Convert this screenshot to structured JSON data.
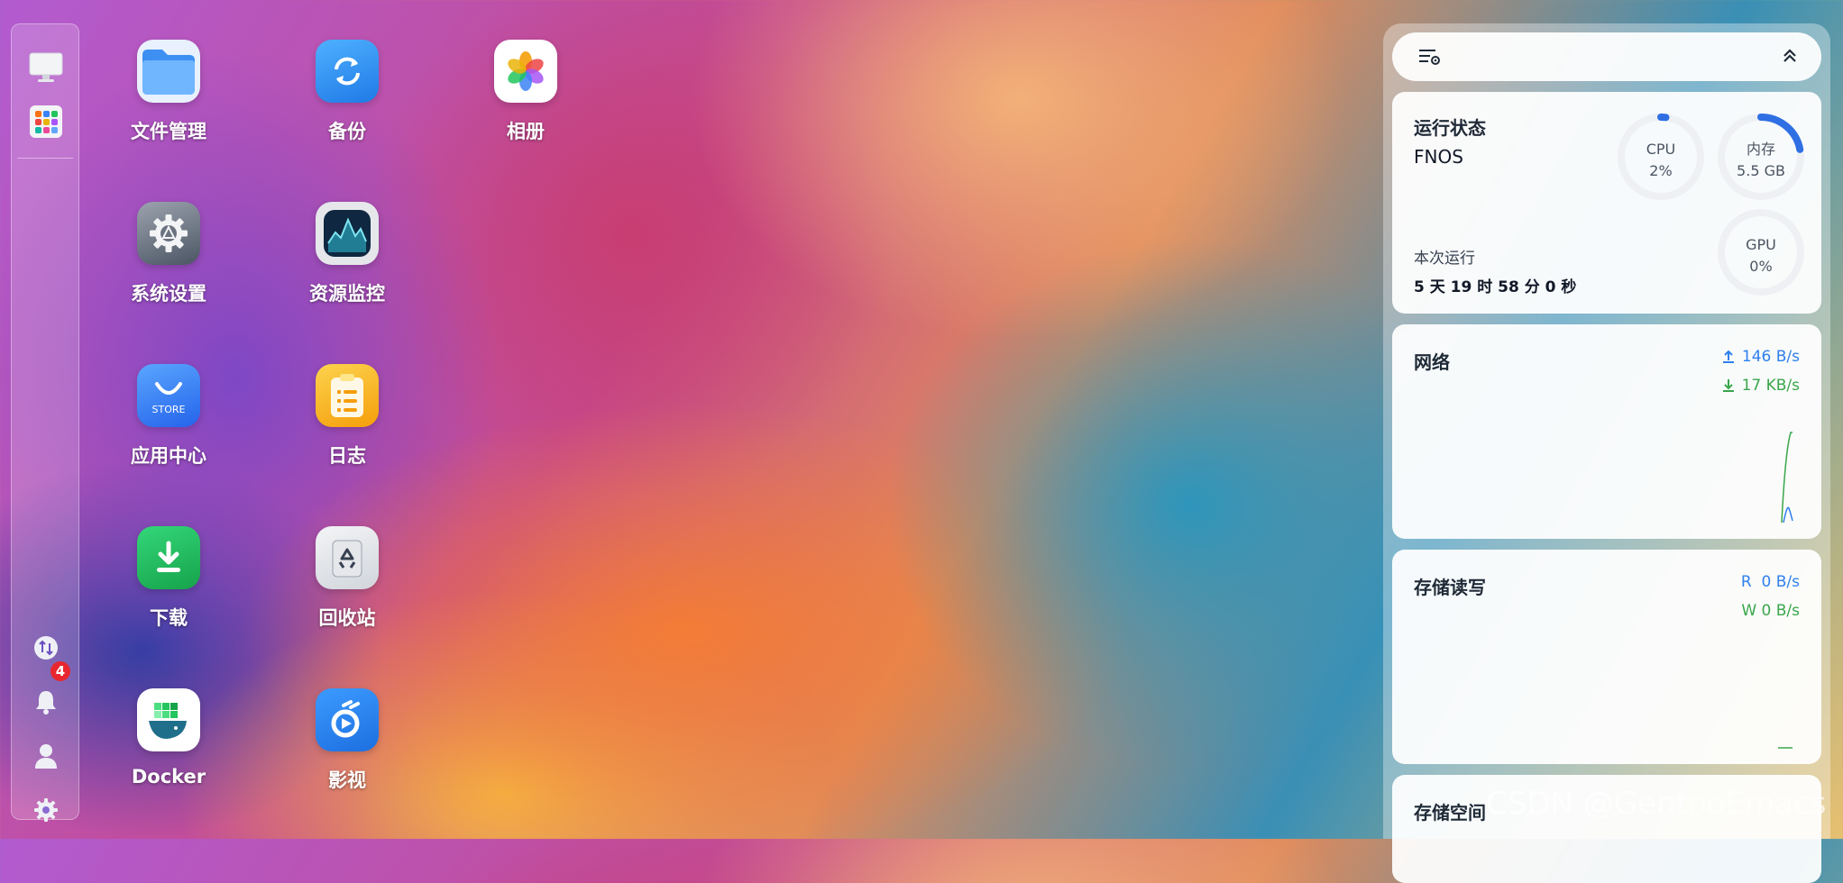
{
  "sidebar": {
    "top_items": [
      {
        "name": "desktop-icon"
      },
      {
        "name": "app-launcher-icon"
      }
    ],
    "bottom_items": [
      {
        "name": "transfer-icon"
      },
      {
        "name": "bell-icon"
      },
      {
        "name": "user-icon"
      },
      {
        "name": "settings-gear-icon"
      }
    ],
    "notification_count": "4"
  },
  "desktop": {
    "apps": [
      {
        "label": "文件管理",
        "icon": "folder-icon",
        "color": "#4aa3f5"
      },
      {
        "label": "备份",
        "icon": "backup-sync-icon",
        "color": "#2f8df0"
      },
      {
        "label": "相册",
        "icon": "photos-flower-icon",
        "color": "#ffffff"
      },
      {
        "label": "系统设置",
        "icon": "gear-icon",
        "color": "#6b7280"
      },
      {
        "label": "资源监控",
        "icon": "resource-monitor-icon",
        "color": "#1e3a5f"
      },
      {
        "label": "应用中心",
        "icon": "store-bag-icon",
        "color": "#3b82f6"
      },
      {
        "label": "日志",
        "icon": "log-clipboard-icon",
        "color": "#f5b53b"
      },
      {
        "label": "下载",
        "icon": "download-icon",
        "color": "#22c55e"
      },
      {
        "label": "回收站",
        "icon": "recycle-bin-icon",
        "color": "#e5e7eb"
      },
      {
        "label": "Docker",
        "icon": "docker-whale-icon",
        "color": "#ffffff"
      },
      {
        "label": "影视",
        "icon": "video-play-icon",
        "color": "#2f80ed"
      }
    ]
  },
  "panel": {
    "toolbar": {
      "filter_icon": "widget-settings-icon",
      "collapse_icon": "chevron-double-up-icon"
    },
    "status": {
      "title": "运行状态",
      "hostname": "FNOS",
      "uptime_label": "本次运行",
      "uptime_value": "5 天 19 时 58 分 0 秒",
      "cpu": {
        "label": "CPU",
        "value": "2%",
        "fraction": 0.02
      },
      "memory": {
        "label": "内存",
        "value": "5.5 GB",
        "fraction": 0.22
      },
      "gpu": {
        "label": "GPU",
        "value": "0%",
        "fraction": 0
      }
    },
    "network": {
      "title": "网络",
      "upload": "146 B/s",
      "download": "17 KB/s",
      "upload_color": "#2f80ed",
      "download_color": "#3aa64b"
    },
    "storage_io": {
      "title": "存储读写",
      "read": "R  0 B/s",
      "write": "W 0 B/s"
    },
    "storage_space": {
      "title": "存储空间"
    }
  },
  "watermark": "CSDN @GentooEmacs"
}
